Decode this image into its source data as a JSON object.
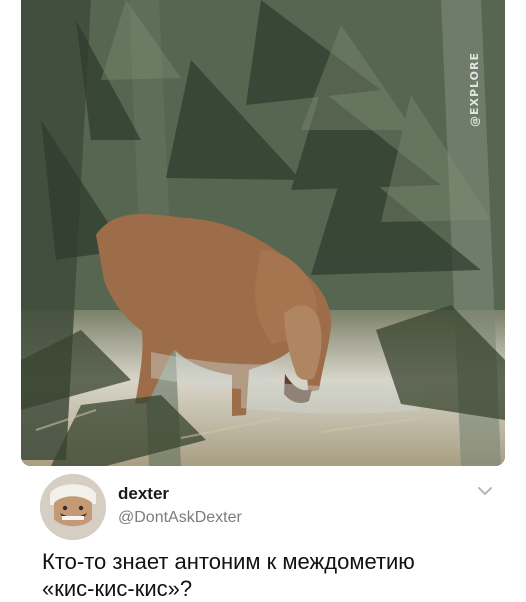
{
  "photo": {
    "alt": "cougar in forest",
    "watermark": "@EXPLORE"
  },
  "tweet": {
    "author_name": "dexter",
    "author_handle": "@DontAskDexter",
    "text": "Кто-то знает антоним к междометию «кис-кис-кис»?"
  },
  "icons": {
    "menu": "chevron-down-icon",
    "avatar": "avatar"
  }
}
